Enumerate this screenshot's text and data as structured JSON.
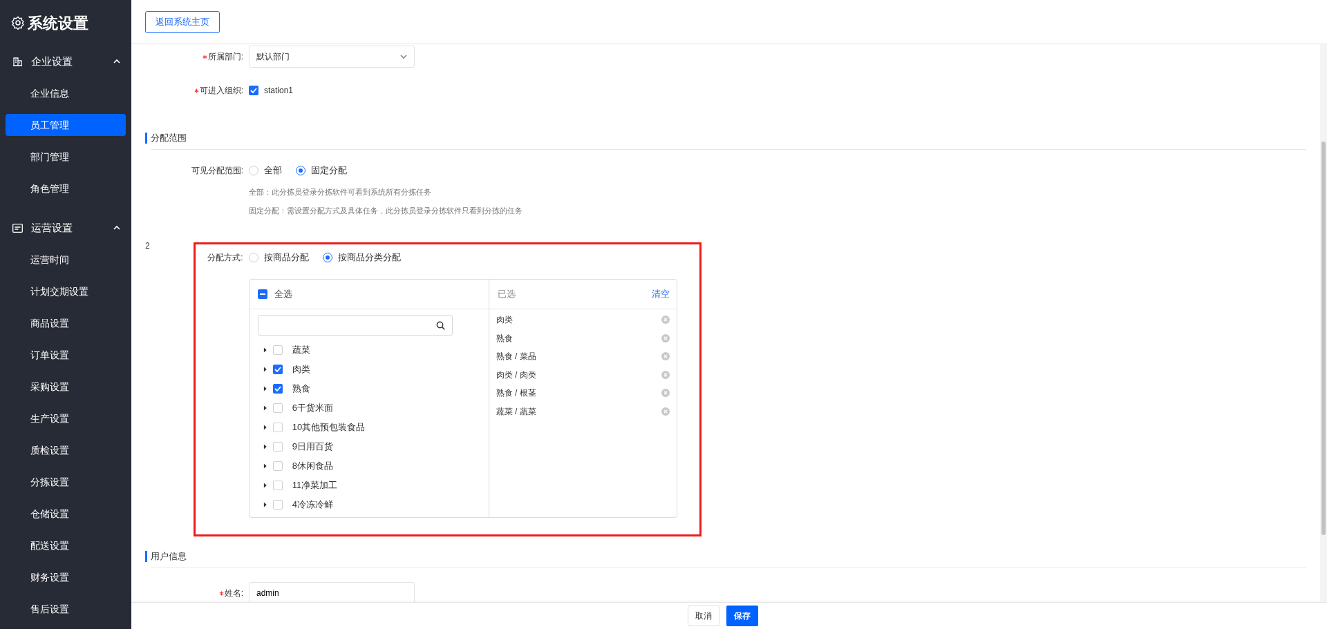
{
  "sidebar": {
    "title": "系统设置",
    "groups": [
      {
        "label": "企业设置",
        "kind": "building",
        "expanded": true,
        "items": [
          {
            "label": "企业信息",
            "selected": false
          },
          {
            "label": "员工管理",
            "selected": true
          },
          {
            "label": "部门管理",
            "selected": false
          },
          {
            "label": "角色管理",
            "selected": false
          }
        ]
      },
      {
        "label": "运营设置",
        "kind": "list",
        "expanded": true,
        "items": [
          {
            "label": "运营时间",
            "selected": false
          },
          {
            "label": "计划交期设置",
            "selected": false
          },
          {
            "label": "商品设置",
            "selected": false
          },
          {
            "label": "订单设置",
            "selected": false
          },
          {
            "label": "采购设置",
            "selected": false
          },
          {
            "label": "生产设置",
            "selected": false
          },
          {
            "label": "质检设置",
            "selected": false
          },
          {
            "label": "分拣设置",
            "selected": false
          },
          {
            "label": "仓储设置",
            "selected": false
          },
          {
            "label": "配送设置",
            "selected": false
          },
          {
            "label": "财务设置",
            "selected": false
          },
          {
            "label": "售后设置",
            "selected": false
          }
        ]
      }
    ]
  },
  "header": {
    "back_button": "返回系统主页"
  },
  "department": {
    "label": "所属部门:",
    "required": true,
    "value": "默认部门"
  },
  "organizations": {
    "label": "可进入组织:",
    "required": true,
    "options": [
      {
        "label": "station1",
        "checked": true
      }
    ]
  },
  "scope_section": {
    "title": "分配范围",
    "visible_scope": {
      "label": "可见分配范围:",
      "options": [
        {
          "label": "全部",
          "selected": false
        },
        {
          "label": "固定分配",
          "selected": true
        }
      ],
      "help": [
        "全部：此分拣员登录分拣软件可看到系统所有分拣任务",
        "固定分配：需设置分配方式及具体任务，此分拣员登录分拣软件只看到分拣的任务"
      ]
    },
    "marker": "2",
    "method": {
      "label": "分配方式:",
      "options": [
        {
          "label": "按商品分配",
          "selected": false
        },
        {
          "label": "按商品分类分配",
          "selected": true
        }
      ]
    },
    "transfer": {
      "select_all": {
        "label": "全选",
        "indeterminate": true
      },
      "tree": [
        {
          "label": "蔬菜",
          "checked": false,
          "expanded": false
        },
        {
          "label": "肉类",
          "checked": true,
          "expanded": false
        },
        {
          "label": "熟食",
          "checked": true,
          "expanded": false
        },
        {
          "label": "6干货米面",
          "checked": false,
          "expanded": false
        },
        {
          "label": "10其他预包装食品",
          "checked": false,
          "expanded": false
        },
        {
          "label": "9日用百货",
          "checked": false,
          "expanded": false
        },
        {
          "label": "8休闲食品",
          "checked": false,
          "expanded": false
        },
        {
          "label": "11净菜加工",
          "checked": false,
          "expanded": false
        },
        {
          "label": "4冷冻冷鲜",
          "checked": false,
          "expanded": false
        }
      ],
      "selected_title": "已选",
      "clear": "清空",
      "selected_items": [
        "肉类",
        "熟食",
        "熟食 / 菜品",
        "肉类 / 肉类",
        "熟食 / 根茎",
        "蔬菜 / 蔬菜"
      ]
    }
  },
  "user_section": {
    "title": "用户信息",
    "name": {
      "label": "姓名:",
      "required": true,
      "value": "admin"
    }
  },
  "footer": {
    "buttons": [
      {
        "label": "取消",
        "kind": "default"
      },
      {
        "label": "保存",
        "kind": "primary"
      }
    ]
  }
}
